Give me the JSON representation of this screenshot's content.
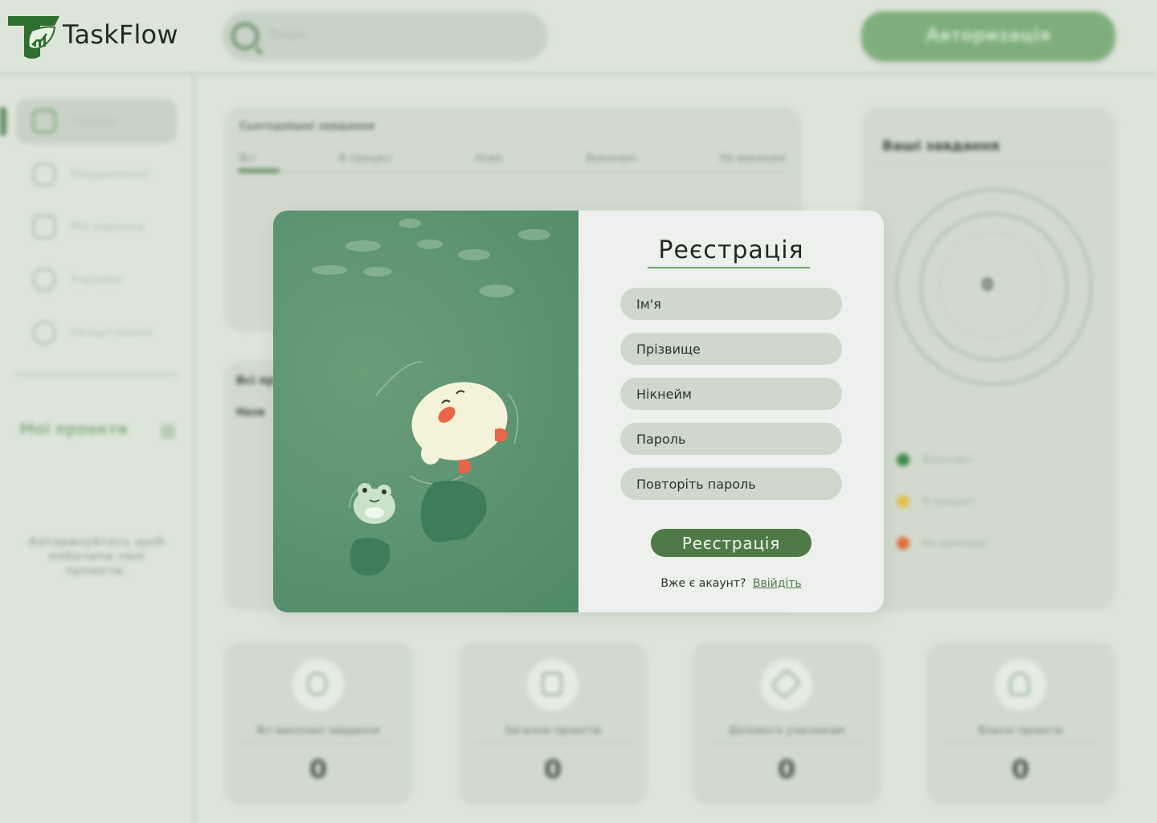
{
  "app": {
    "name": "TaskFlow"
  },
  "header": {
    "search_placeholder": "Пошук...",
    "auth_button": "Авторизація"
  },
  "sidebar": {
    "items": [
      {
        "label": "Головна"
      },
      {
        "label": "Повідомлення"
      },
      {
        "label": "Мої завдання"
      },
      {
        "label": "Учасники"
      },
      {
        "label": "Налаштування"
      }
    ],
    "my_projects": "Мої проекти",
    "hint": "Авторизуйтесь щоб побачити свої проекти."
  },
  "today_tasks": {
    "title": "Сьогоднішні завдання",
    "tabs": [
      "Всі",
      "В процесі",
      "Нове",
      "Виконані",
      "Не виконані"
    ]
  },
  "all_projects": {
    "title": "Всі пр",
    "subtitle": "Назв"
  },
  "your_tasks": {
    "title": "Ваші завдання",
    "count": "0",
    "legend": [
      {
        "label": "Виконані",
        "color": "#3f8a46"
      },
      {
        "label": "В процесі",
        "color": "#e2c14a"
      },
      {
        "label": "Не виконані",
        "color": "#e06a3c"
      }
    ]
  },
  "stats": [
    {
      "label": "Всі виконані завдання",
      "value": "0",
      "icon": "award-icon"
    },
    {
      "label": "Загалом проектів",
      "value": "0",
      "icon": "clipboard-icon"
    },
    {
      "label": "Допомога учасникам",
      "value": "0",
      "icon": "help-icon"
    },
    {
      "label": "Власні проекти",
      "value": "0",
      "icon": "user-star-icon"
    }
  ],
  "modal": {
    "title": "Реєстрація",
    "fields": {
      "name": "Ім'я",
      "surname": "Прізвище",
      "nickname": "Нікнейм",
      "password": "Пароль",
      "password_repeat": "Повторіть пароль"
    },
    "submit": "Реєстрація",
    "have_account": "Вже є акаунт?",
    "login_link": "Ввійдіть"
  }
}
